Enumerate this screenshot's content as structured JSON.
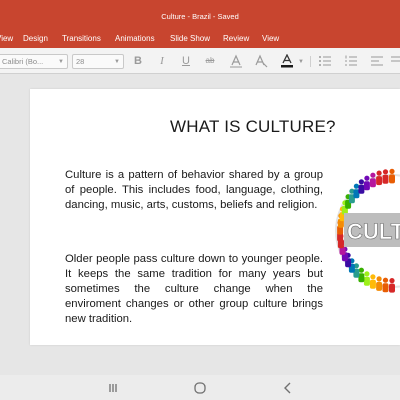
{
  "window": {
    "title": "Culture - Brazil - Saved"
  },
  "ribbon": {
    "tabs": [
      "View",
      "Design",
      "Transitions",
      "Animations",
      "Slide Show",
      "Review",
      "View"
    ]
  },
  "toolbar": {
    "font_name": "Calibri (Bo...",
    "font_size": "28",
    "icons": [
      "bold-icon",
      "italic-icon",
      "underline-icon",
      "strikethrough-icon",
      "clear-formatting-icon",
      "text-effects-icon",
      "font-color-icon",
      "bullets-icon",
      "numbering-icon",
      "align-icon"
    ],
    "font_color_hex": "#1a1a1a"
  },
  "slide": {
    "title": "WHAT IS CULTURE?",
    "paragraph1": "Culture is a pattern of behavior shared by a group of people. This includes food, language, clothing, dancing, music, arts, customs, beliefs and religion.",
    "paragraph2": "Older people pass culture down to younger people. It keeps the same tradition for many years but sometimes the culture change when the enviroment changes or other group culture brings new tradition.",
    "image_text": "CULT"
  },
  "colors": {
    "accent": "#c8452f",
    "toolbar_bg": "#f3f3f3",
    "workarea_bg": "#e6e6e6"
  },
  "navbar": {
    "icons": [
      "recents-icon",
      "home-icon",
      "back-icon"
    ]
  }
}
